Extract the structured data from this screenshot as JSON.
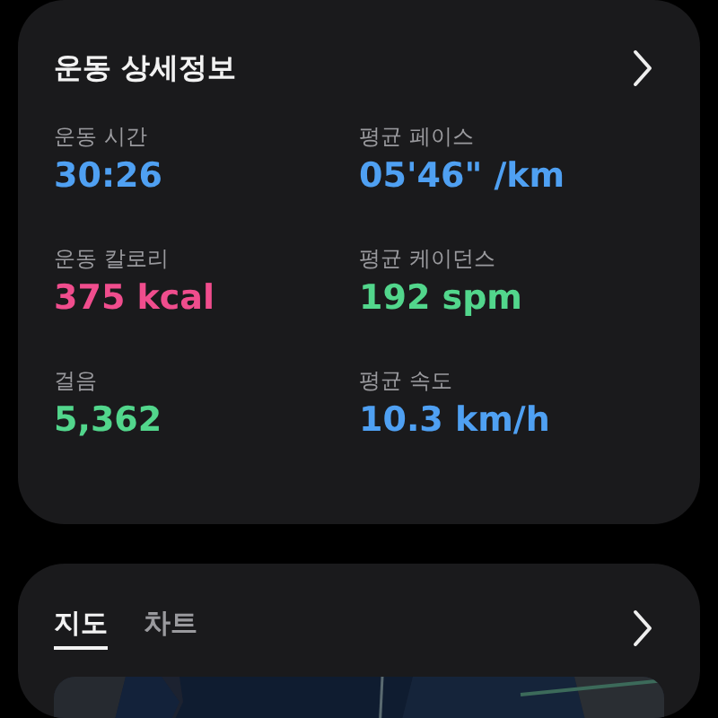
{
  "details_card": {
    "title": "운동 상세정보",
    "metrics": [
      {
        "label": "운동 시간",
        "value": "30:26",
        "color": "#4fa0f2"
      },
      {
        "label": "평균 페이스",
        "value": "05'46\" /km",
        "color": "#4fa0f2"
      },
      {
        "label": "운동 칼로리",
        "value": "375 kcal",
        "color": "#f04d8d"
      },
      {
        "label": "평균 케이던스",
        "value": "192 spm",
        "color": "#52d68c"
      },
      {
        "label": "걸음",
        "value": "5,362",
        "color": "#52d68c"
      },
      {
        "label": "평균 속도",
        "value": "10.3 km/h",
        "color": "#4fa0f2"
      }
    ]
  },
  "map_card": {
    "tabs": [
      {
        "label": "지도",
        "selected": true
      },
      {
        "label": "차트",
        "selected": false
      }
    ]
  }
}
